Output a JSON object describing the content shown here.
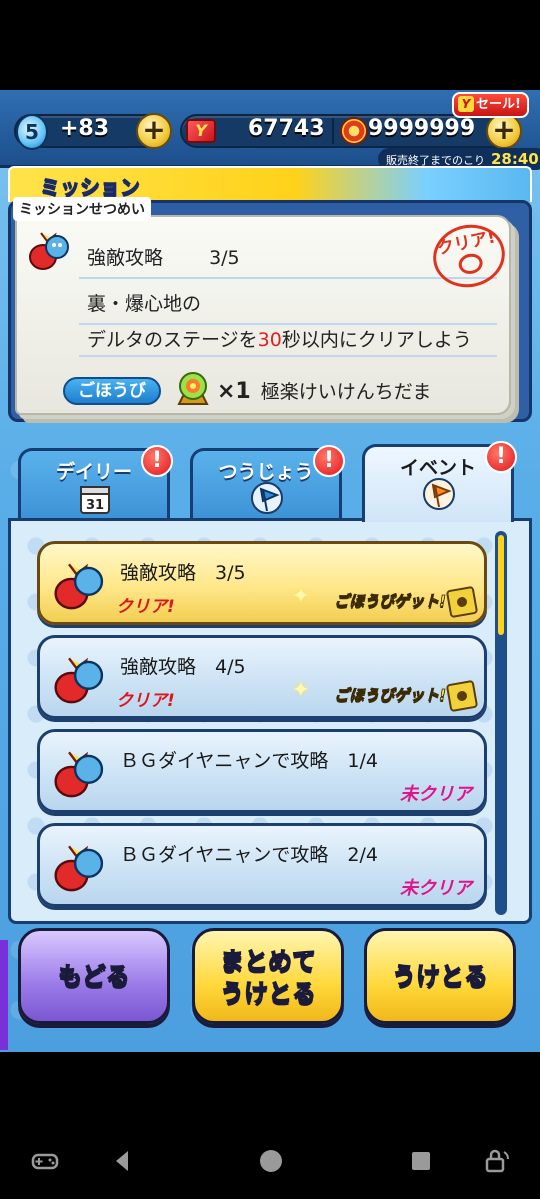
{
  "status_bar": {
    "stamina_level": "5",
    "stamina_bonus": "+83",
    "ymoney": "67743",
    "coins": "9999999",
    "plus_label": "+",
    "sale_label": "セール!",
    "sale_timer_caption": "販売終了までのこり",
    "sale_timer_value": "28:40"
  },
  "mission_header": {
    "title": "ミッション"
  },
  "description": {
    "label": "ミッションせつめい",
    "mission_name": "強敵攻略",
    "mission_progress": "3/5",
    "stamp_text": "クリア!",
    "line1": "裏・爆心地の",
    "line2_pre": "デルタのステージを",
    "line2_highlight": "30",
    "line2_post": "秒以内にクリアしよう",
    "reward_label": "ごほうび",
    "reward_count": "×1",
    "reward_name": "極楽けいけんちだま"
  },
  "tabs": [
    {
      "label": "デイリー",
      "alert": "!"
    },
    {
      "label": "つうじょう",
      "alert": "!"
    },
    {
      "label": "イベント",
      "alert": "!"
    }
  ],
  "missions": [
    {
      "name": "強敵攻略　3/5",
      "status": "クリア!",
      "action": "ごほうびゲット!"
    },
    {
      "name": "強敵攻略　4/5",
      "status": "クリア!",
      "action": "ごほうびゲット!"
    },
    {
      "name": "ＢＧダイヤニャンで攻略　1/4",
      "status": "未クリア"
    },
    {
      "name": "ＢＧダイヤニャンで攻略　2/4",
      "status": "未クリア"
    }
  ],
  "buttons": {
    "back": "もどる",
    "collect_all_line1": "まとめて",
    "collect_all_line2": "うけとる",
    "collect": "うけとる"
  },
  "colors": {
    "accent_blue": "#2f6fb2",
    "highlight_yellow": "#ffd21a",
    "clear_red": "#e0141c",
    "not_clear_pink": "#e0148a"
  }
}
